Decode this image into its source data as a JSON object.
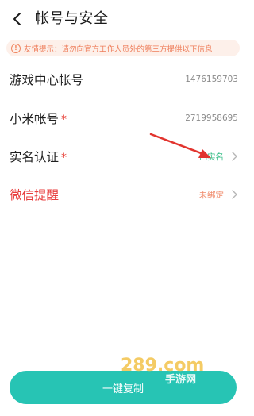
{
  "header": {
    "title": "帐号与安全"
  },
  "notice": {
    "text": "友情提示：请勿向官方工作人员外的第三方提供以下信息"
  },
  "rows": [
    {
      "label": "游戏中心帐号",
      "value": "1476159703",
      "required": false
    },
    {
      "label": "小米帐号",
      "value": "2719958695",
      "required": true,
      "required_mark": "*"
    },
    {
      "label": "实名认证",
      "value": "已实名",
      "required": true,
      "required_mark": "*"
    },
    {
      "label": "微信提醒",
      "value": "未绑定"
    }
  ],
  "button": {
    "label": "一键复制"
  },
  "watermark": {
    "text": "289.com",
    "sub": "手游网"
  },
  "colors": {
    "accent": "#27c4b4",
    "warning": "#ee7d5a",
    "danger": "#e83d3d",
    "verified": "#3bbf8a"
  }
}
